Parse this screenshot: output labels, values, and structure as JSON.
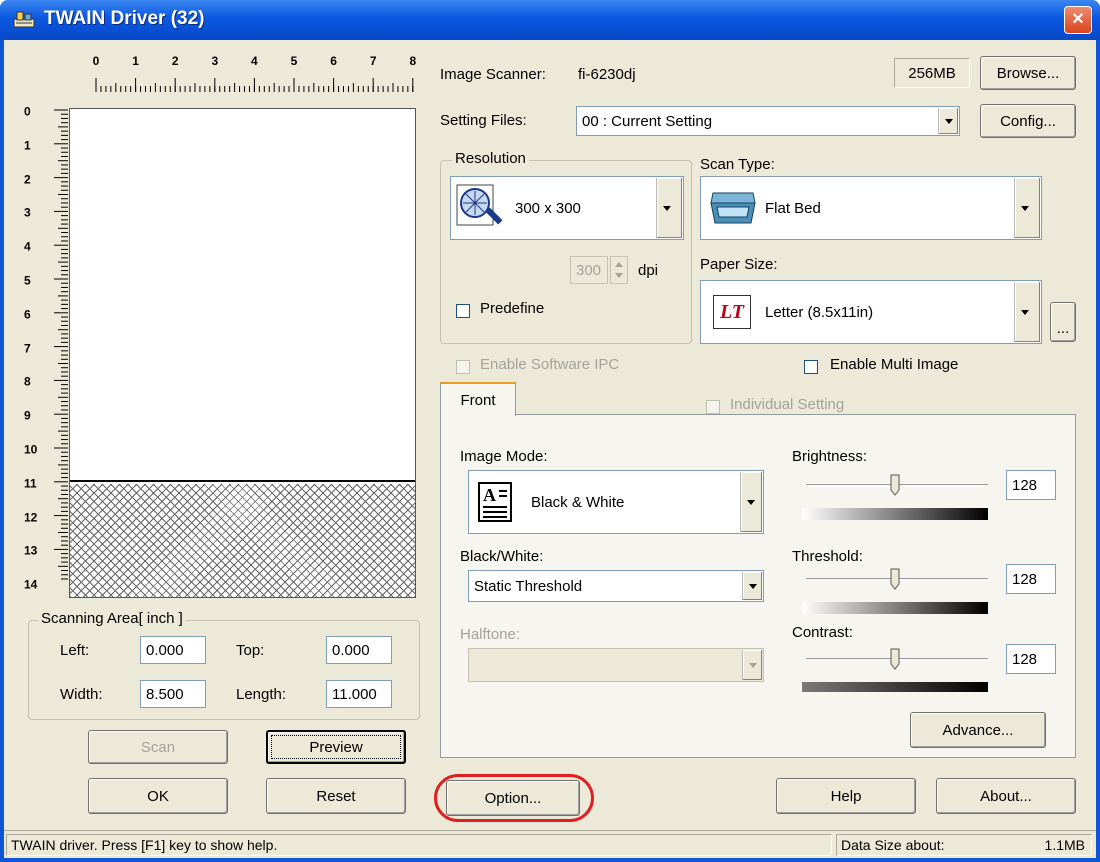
{
  "window": {
    "title": "TWAIN Driver (32)",
    "close_label": "×"
  },
  "preview": {
    "ruler_top": [
      "0",
      "1",
      "2",
      "3",
      "4",
      "5",
      "6",
      "7",
      "8"
    ],
    "ruler_left": [
      "0",
      "1",
      "2",
      "3",
      "4",
      "5",
      "6",
      "7",
      "8",
      "9",
      "10",
      "11",
      "12",
      "13",
      "14"
    ]
  },
  "scanning_area": {
    "legend": "Scanning Area[ inch ]",
    "left_label": "Left:",
    "left_value": "0.000",
    "top_label": "Top:",
    "top_value": "0.000",
    "width_label": "Width:",
    "width_value": "8.500",
    "length_label": "Length:",
    "length_value": "11.000"
  },
  "buttons": {
    "scan": "Scan",
    "preview": "Preview",
    "ok": "OK",
    "reset": "Reset",
    "option": "Option...",
    "help": "Help",
    "about": "About...",
    "browse": "Browse...",
    "config": "Config...",
    "advance": "Advance...",
    "paper_more": "..."
  },
  "scanner": {
    "label": "Image Scanner:",
    "model": "fi-6230dj",
    "memory": "256MB"
  },
  "setting_files": {
    "label": "Setting Files:",
    "value": "00 : Current Setting"
  },
  "resolution": {
    "legend": "Resolution",
    "value": "300 x 300",
    "custom_value": "300",
    "unit": "dpi",
    "predefine_label": "Predefine"
  },
  "scan_type": {
    "label": "Scan Type:",
    "value": "Flat Bed"
  },
  "paper_size": {
    "label": "Paper Size:",
    "icon_text": "LT",
    "value": "Letter (8.5x11in)"
  },
  "options": {
    "enable_software_ipc": "Enable Software IPC",
    "enable_multi_image": "Enable Multi Image",
    "individual_setting": "Individual Setting"
  },
  "tabs": {
    "front": "Front"
  },
  "image": {
    "mode_label": "Image Mode:",
    "mode_value": "Black & White",
    "bw_label": "Black/White:",
    "bw_value": "Static Threshold",
    "halftone_label": "Halftone:",
    "halftone_value": ""
  },
  "sliders": {
    "brightness_label": "Brightness:",
    "brightness_value": "128",
    "threshold_label": "Threshold:",
    "threshold_value": "128",
    "contrast_label": "Contrast:",
    "contrast_value": "128"
  },
  "status": {
    "help_text": "TWAIN driver. Press [F1] key to show help.",
    "data_size_label": "Data Size about:",
    "data_size_value": "1.1MB"
  },
  "colors": {
    "titlebar": "#0b58e0",
    "dialog_bg": "#ece9d8",
    "highlight": "#e02020"
  }
}
